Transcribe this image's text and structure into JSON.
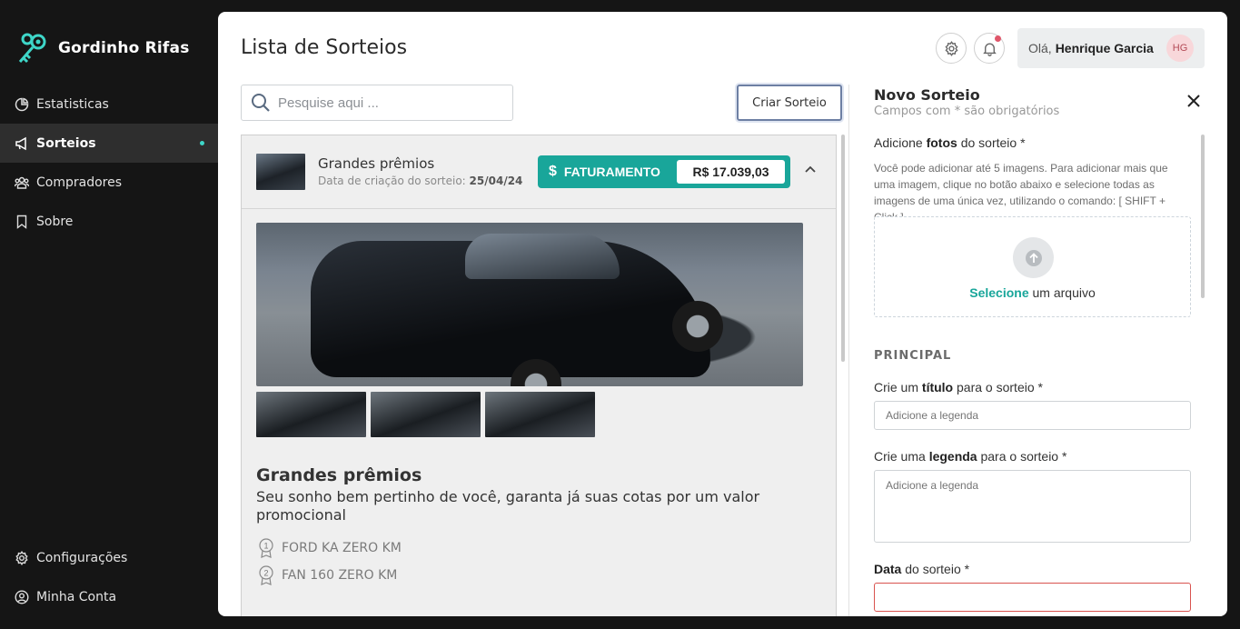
{
  "app": {
    "brand": "Gordinho Rifas"
  },
  "sidebar": {
    "items": [
      {
        "label": "Estatisticas",
        "icon": "chart-pie-icon"
      },
      {
        "label": "Sorteios",
        "icon": "megaphone-icon",
        "active": true
      },
      {
        "label": "Compradores",
        "icon": "users-icon"
      },
      {
        "label": "Sobre",
        "icon": "bookmark-icon"
      }
    ],
    "bottom": [
      {
        "label": "Configurações",
        "icon": "gear-icon"
      },
      {
        "label": "Minha Conta",
        "icon": "user-circle-icon"
      }
    ]
  },
  "header": {
    "title": "Lista de Sorteios",
    "greeting": "Olá,",
    "user_name": "Henrique Garcia",
    "avatar_initials": "HG"
  },
  "search": {
    "placeholder": "Pesquise aqui ..."
  },
  "create_button": "Criar Sorteio",
  "raffle": {
    "title": "Grandes prêmios",
    "date_label": "Data de criação do sorteio:",
    "date_value": "25/04/24",
    "revenue_label": "FATURAMENTO",
    "revenue_value": "R$ 17.039,03",
    "desc_title": "Grandes prêmios",
    "desc_subtitle": "Seu sonho bem pertinho de você, garanta já suas cotas por um valor promocional",
    "prizes": [
      {
        "rank": "1",
        "name": "FORD KA ZERO KM"
      },
      {
        "rank": "2",
        "name": "FAN 160 ZERO KM"
      }
    ]
  },
  "new_raffle": {
    "title": "Novo Sorteio",
    "subtitle": "Campos com * são obrigatórios",
    "photos_label_pre": "Adicione ",
    "photos_label_bold": "fotos",
    "photos_label_post": " do sorteio *",
    "photos_hint": "Você pode adicionar até 5 imagens. Para adicionar mais que uma imagem, clique no botão abaixo e selecione todas as imagens de uma única vez, utilizando o comando: [ SHIFT + Click ]",
    "upload_link": "Selecione",
    "upload_text": " um arquivo",
    "section_main": "PRINCIPAL",
    "title_label_pre": "Crie um ",
    "title_label_bold": "título",
    "title_label_post": " para o sorteio *",
    "title_placeholder": "Adicione a legenda",
    "caption_label_pre": "Crie uma ",
    "caption_label_bold": "legenda",
    "caption_label_post": " para o sorteio *",
    "caption_placeholder": "Adicione a legenda",
    "date_label_bold": "Data",
    "date_label_post": " do sorteio *"
  }
}
